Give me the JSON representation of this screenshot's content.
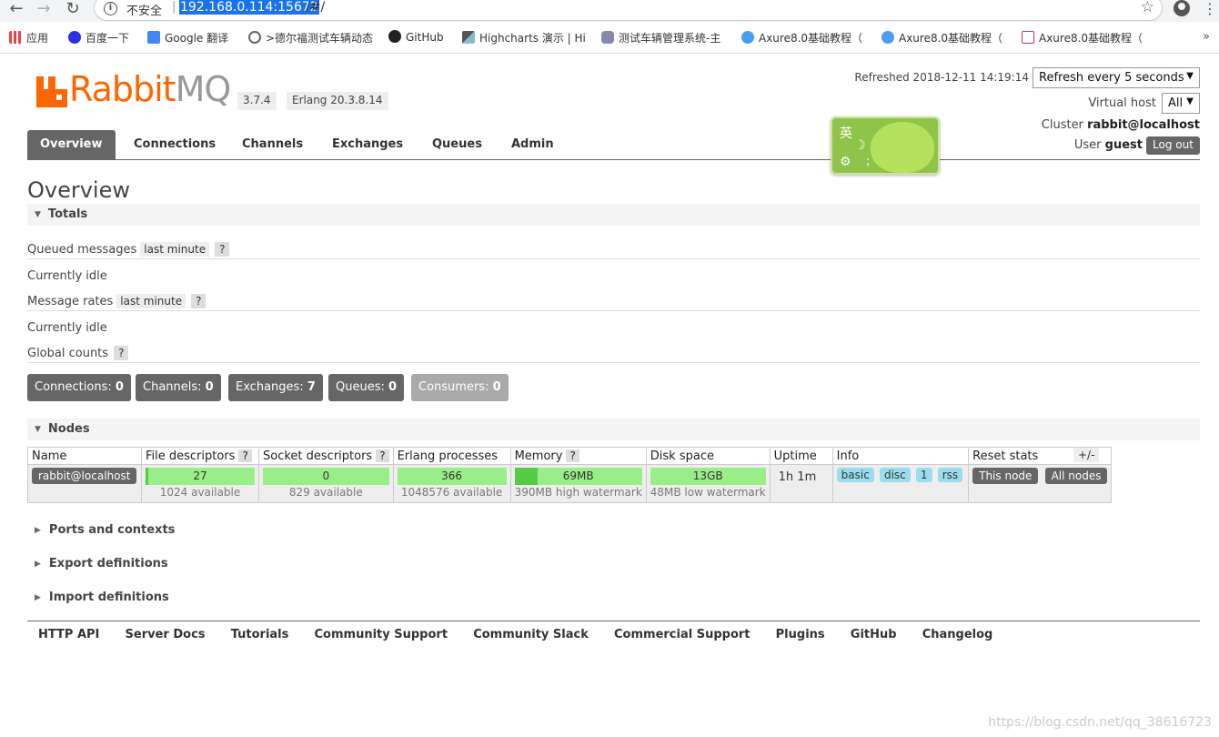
{
  "browser": {
    "back": "←",
    "forward": "→",
    "reload": "↻",
    "insecure_label": "不安全",
    "url_host": "192.168.0.114:15672",
    "url_rest": "/#/",
    "star": "☆",
    "more": "⋮",
    "bookmarks": [
      {
        "label": "应用",
        "color": "#e44"
      },
      {
        "label": "百度一下",
        "color": "#2932e1"
      },
      {
        "label": "Google 翻译",
        "color": "#4285f4"
      },
      {
        "label": ">德尔福测试车辆动态",
        "color": "#666"
      },
      {
        "label": "GitHub",
        "color": "#222"
      },
      {
        "label": "Highcharts 演示 | Hi",
        "color": "#555"
      },
      {
        "label": "测试车辆管理系统-主",
        "color": "#88a"
      },
      {
        "label": "Axure8.0基础教程（",
        "color": "#4a9df0"
      },
      {
        "label": "Axure8.0基础教程（",
        "color": "#4a9df0"
      },
      {
        "label": "Axure8.0基础教程（",
        "color": "#c36"
      }
    ],
    "bookmarks_more": "»"
  },
  "header": {
    "logo_rabbit": "Rabbit",
    "logo_mq": "MQ",
    "version": "3.7.4",
    "erlang": "Erlang 20.3.8.14",
    "refreshed": "Refreshed 2018-12-11 14:19:14",
    "refresh_select": "Refresh every 5 seconds",
    "vhost_label": "Virtual host",
    "vhost_select": "All",
    "cluster_label": "Cluster",
    "cluster_value": "rabbit@localhost",
    "user_label": "User",
    "user_value": "guest",
    "logout": "Log out"
  },
  "ime": {
    "char": "英",
    "moon": "☽",
    "gear": "⚙",
    "semi": ";"
  },
  "tabs": [
    "Overview",
    "Connections",
    "Channels",
    "Exchanges",
    "Queues",
    "Admin"
  ],
  "page_title": "Overview",
  "totals": {
    "heading": "Totals",
    "queued_label": "Queued messages",
    "queued_range": "last minute",
    "help": "?",
    "idle1": "Currently idle",
    "rates_label": "Message rates",
    "rates_range": "last minute",
    "idle2": "Currently idle",
    "global_label": "Global counts"
  },
  "counts": [
    {
      "label": "Connections:",
      "value": "0"
    },
    {
      "label": "Channels:",
      "value": "0"
    },
    {
      "label": "Exchanges:",
      "value": "7"
    },
    {
      "label": "Queues:",
      "value": "0"
    },
    {
      "label": "Consumers:",
      "value": "0"
    }
  ],
  "nodes": {
    "heading": "Nodes",
    "columns": [
      "Name",
      "File descriptors",
      "Socket descriptors",
      "Erlang processes",
      "Memory",
      "Disk space",
      "Uptime",
      "Info",
      "Reset stats"
    ],
    "plusminus": "+/-",
    "row": {
      "name": "rabbit@localhost",
      "fd": {
        "value": "27",
        "sub": "1024 available",
        "fill": 0.026
      },
      "sd": {
        "value": "0",
        "sub": "829 available",
        "fill": 0
      },
      "ep": {
        "value": "366",
        "sub": "1048576 available",
        "fill": 0.0003
      },
      "mem": {
        "value": "69MB",
        "sub": "390MB high watermark",
        "fill": 0.18
      },
      "disk": {
        "value": "13GB",
        "sub": "48MB low watermark",
        "fill": 0
      },
      "uptime": "1h 1m",
      "info": [
        "basic",
        "disc",
        "1",
        "rss"
      ],
      "reset_this": "This node",
      "reset_all": "All nodes"
    }
  },
  "collapsed": [
    "Ports and contexts",
    "Export definitions",
    "Import definitions"
  ],
  "footer": [
    "HTTP API",
    "Server Docs",
    "Tutorials",
    "Community Support",
    "Community Slack",
    "Commercial Support",
    "Plugins",
    "GitHub",
    "Changelog"
  ],
  "watermark": "https://blog.csdn.net/qq_38616723"
}
